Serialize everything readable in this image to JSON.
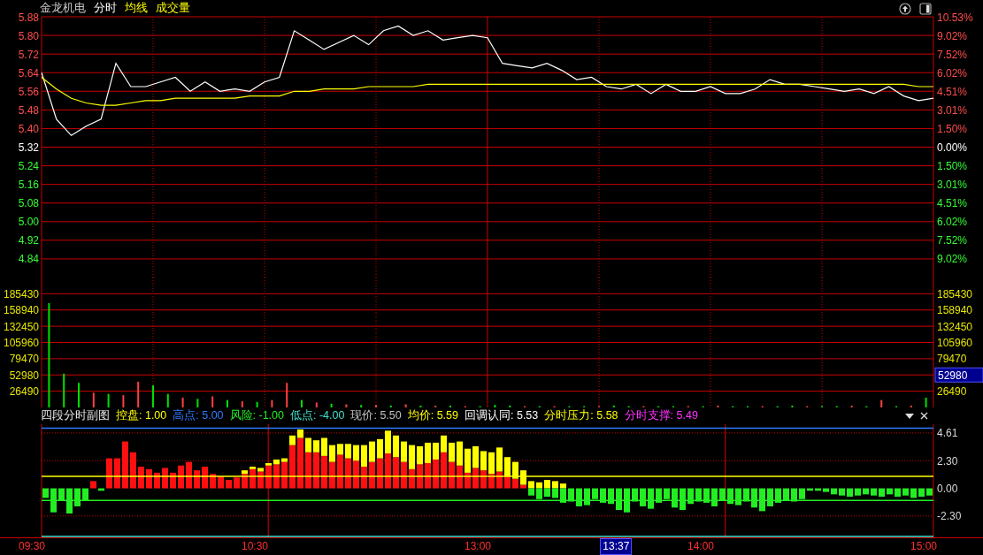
{
  "header": {
    "title": "金龙机电",
    "volume_label": "成交量"
  },
  "price_chart": {
    "percent_labels": [
      {
        "text": "10.53%",
        "color": "#ff4d4d"
      },
      {
        "text": "9.02%",
        "color": "#ff4d4d"
      },
      {
        "text": "7.52%",
        "color": "#ff4d4d"
      },
      {
        "text": "6.02%",
        "color": "#ff4d4d"
      },
      {
        "text": "4.51%",
        "color": "#ff4d4d"
      },
      {
        "text": "3.01%",
        "color": "#ff4d4d"
      },
      {
        "text": "1.50%",
        "color": "#ff4d4d"
      },
      {
        "text": "0.00%",
        "color": "#ffffff"
      },
      {
        "text": "1.50%",
        "color": "#33ff33"
      },
      {
        "text": "3.01%",
        "color": "#33ff33"
      },
      {
        "text": "4.51%",
        "color": "#33ff33"
      },
      {
        "text": "6.02%",
        "color": "#33ff33"
      },
      {
        "text": "7.52%",
        "color": "#33ff33"
      },
      {
        "text": "9.02%",
        "color": "#33ff33"
      }
    ],
    "chart_data": {
      "type": "line",
      "grid": true,
      "ylim": [
        4.76,
        5.88
      ],
      "yticks": [
        {
          "value": 5.88,
          "label": "5.88"
        },
        {
          "value": 5.8,
          "label": "5.80"
        },
        {
          "value": 5.72,
          "label": "5.72"
        },
        {
          "value": 5.64,
          "label": "5.64"
        },
        {
          "value": 5.56,
          "label": "5.56"
        },
        {
          "value": 5.48,
          "label": "5.48"
        },
        {
          "value": 5.4,
          "label": "5.40"
        },
        {
          "value": 5.32,
          "label": "5.32"
        },
        {
          "value": 5.24,
          "label": "5.24"
        },
        {
          "value": 5.16,
          "label": "5.16"
        },
        {
          "value": 5.08,
          "label": "5.08"
        },
        {
          "value": 5.0,
          "label": "5.00"
        },
        {
          "value": 4.92,
          "label": "4.92"
        },
        {
          "value": 4.84,
          "label": "4.84"
        }
      ],
      "series": [
        {
          "name": "分时",
          "color": "#ffffff",
          "values": [
            5.64,
            5.44,
            5.37,
            5.41,
            5.44,
            5.68,
            5.58,
            5.58,
            5.6,
            5.62,
            5.56,
            5.6,
            5.56,
            5.57,
            5.56,
            5.6,
            5.62,
            5.82,
            5.78,
            5.74,
            5.77,
            5.8,
            5.76,
            5.82,
            5.84,
            5.8,
            5.82,
            5.78,
            5.79,
            5.8,
            5.79,
            5.68,
            5.67,
            5.66,
            5.68,
            5.65,
            5.61,
            5.62,
            5.58,
            5.57,
            5.59,
            5.55,
            5.59,
            5.56,
            5.56,
            5.58,
            5.55,
            5.55,
            5.57,
            5.61,
            5.59,
            5.59,
            5.58,
            5.57,
            5.56,
            5.57,
            5.55,
            5.58,
            5.54,
            5.52,
            5.53
          ]
        },
        {
          "name": "均线",
          "color": "#ffff00",
          "values": [
            5.62,
            5.57,
            5.53,
            5.51,
            5.5,
            5.5,
            5.51,
            5.52,
            5.52,
            5.53,
            5.53,
            5.53,
            5.53,
            5.53,
            5.54,
            5.54,
            5.54,
            5.56,
            5.56,
            5.57,
            5.57,
            5.57,
            5.58,
            5.58,
            5.58,
            5.58,
            5.59,
            5.59,
            5.59,
            5.59,
            5.59,
            5.59,
            5.59,
            5.59,
            5.59,
            5.59,
            5.59,
            5.59,
            5.59,
            5.59,
            5.59,
            5.59,
            5.59,
            5.59,
            5.59,
            5.59,
            5.59,
            5.59,
            5.59,
            5.59,
            5.59,
            5.59,
            5.59,
            5.59,
            5.59,
            5.59,
            5.59,
            5.59,
            5.59,
            5.58,
            5.58
          ]
        }
      ]
    }
  },
  "volume_chart": {
    "right_labels": [
      "185430",
      "158940",
      "132450",
      "105960",
      "79470",
      "26490"
    ],
    "cursor_value": "52980",
    "chart_data": {
      "type": "bar",
      "grid": true,
      "ylim": [
        0,
        211920
      ],
      "yticks": [
        {
          "value": 185430,
          "label": "185430"
        },
        {
          "value": 158940,
          "label": "158940"
        },
        {
          "value": 132450,
          "label": "132450"
        },
        {
          "value": 105960,
          "label": "105960"
        },
        {
          "value": 79470,
          "label": "79470"
        },
        {
          "value": 52980,
          "label": "52980"
        },
        {
          "value": 26490,
          "label": "26490"
        }
      ],
      "series": [
        {
          "color": "#ff4040",
          "values": [
            null,
            null,
            null,
            24000,
            null,
            20000,
            42000,
            null,
            null,
            16000,
            null,
            18000,
            null,
            10000,
            null,
            12000,
            40000,
            null,
            8000,
            null,
            5000,
            null,
            4000,
            null,
            5000,
            null,
            3000,
            null,
            2000,
            null,
            null,
            null,
            2000,
            null,
            2000,
            null,
            null,
            2000,
            null,
            null,
            2000,
            null,
            null,
            2000,
            null,
            3000,
            null,
            null,
            2000,
            null,
            null,
            2000,
            null,
            null,
            3000,
            null,
            12000,
            null,
            3000,
            null
          ]
        },
        {
          "color": "#00e000",
          "values": [
            170000,
            55000,
            40000,
            null,
            22000,
            null,
            null,
            36000,
            22000,
            null,
            14000,
            null,
            12000,
            null,
            9000,
            null,
            null,
            12000,
            null,
            6000,
            null,
            4000,
            null,
            3000,
            null,
            3000,
            null,
            3000,
            null,
            2000,
            4000,
            3000,
            null,
            2000,
            null,
            2000,
            2000,
            null,
            3000,
            2000,
            null,
            2000,
            2000,
            null,
            2000,
            null,
            2000,
            2000,
            null,
            2000,
            3000,
            null,
            2000,
            2000,
            null,
            2000,
            null,
            2000,
            null,
            16000
          ]
        }
      ]
    }
  },
  "indicator": {
    "title": "四段分时副图",
    "items": [
      {
        "text": "现价: 5.50",
        "color": "#c0c0c0"
      },
      {
        "text": "均价: 5.59",
        "color": "#ffff00"
      },
      {
        "text": "回调认同: 5.53",
        "color": "#ffffff"
      },
      {
        "text": "分时压力: 5.58",
        "color": "#ffff00"
      },
      {
        "text": "分时支撑: 5.49",
        "color": "#ff33ff"
      }
    ],
    "time_labels": [
      "09:30",
      "10:30",
      "13:00",
      "14:00",
      "15:00"
    ],
    "cursor_time": "13:37",
    "chart_data": {
      "type": "bar",
      "stacked": true,
      "grid": true,
      "ylim": [
        -4.08,
        5.34
      ],
      "yticks": [
        {
          "value": 4.61,
          "label": "4.61"
        },
        {
          "value": 2.3,
          "label": "2.30"
        },
        {
          "value": 0,
          "label": "0.00"
        },
        {
          "value": -2.3,
          "label": "-2.30"
        }
      ],
      "ref_lines": [
        {
          "axis": "y",
          "value": 1,
          "label": "控盘: 1.00",
          "color": "#ffff00"
        },
        {
          "axis": "y",
          "value": 5,
          "label": "高点: 5.00",
          "color": "#2f7bff"
        },
        {
          "axis": "y",
          "value": -1,
          "label": "风险: -1.00",
          "color": "#22ee22"
        },
        {
          "axis": "y",
          "value": -4,
          "label": "低点: -4.00",
          "color": "#40e0d0"
        }
      ],
      "series": [
        {
          "color": "#ff1010",
          "values": [
            null,
            null,
            null,
            null,
            null,
            null,
            0.6,
            null,
            2.5,
            2.5,
            3.9,
            3.0,
            1.8,
            1.6,
            1.3,
            1.7,
            1.3,
            1.9,
            2.2,
            1.5,
            1.8,
            1.2,
            1.0,
            0.7,
            0.9,
            1.2,
            1.6,
            1.4,
            1.9,
            2.0,
            2.2,
            3.6,
            4.2,
            3.0,
            3.0,
            2.7,
            2.2,
            2.8,
            2.5,
            2.3,
            1.8,
            2.2,
            2.5,
            2.9,
            2.6,
            2.2,
            1.6,
            2.0,
            2.1,
            2.4,
            3.0,
            2.2,
            1.9,
            1.3,
            1.7,
            1.5,
            1.2,
            1.4,
            1.0,
            0.8,
            0.3,
            null,
            null,
            null,
            null,
            null,
            null,
            null,
            null,
            null,
            null,
            null,
            null,
            null,
            null,
            null,
            null,
            null,
            null,
            null,
            null,
            null,
            null,
            null,
            null,
            null,
            null,
            null,
            null,
            null,
            null,
            null,
            null,
            null,
            null,
            null,
            null,
            null,
            null,
            null,
            null,
            null,
            null,
            null,
            null,
            null,
            null,
            null,
            null,
            null,
            null,
            null
          ]
        },
        {
          "color": "#ffff00",
          "values": [
            null,
            null,
            null,
            null,
            null,
            null,
            null,
            null,
            null,
            null,
            null,
            null,
            null,
            null,
            null,
            null,
            null,
            null,
            null,
            null,
            null,
            null,
            null,
            null,
            null,
            0.3,
            0.2,
            0.3,
            0.2,
            0.4,
            0.3,
            0.8,
            0.7,
            1.2,
            1.0,
            1.5,
            1.4,
            0.9,
            1.2,
            1.3,
            1.8,
            1.7,
            1.6,
            1.9,
            1.8,
            1.7,
            2.0,
            1.5,
            1.7,
            1.4,
            1.4,
            1.6,
            2.0,
            2.0,
            1.8,
            1.6,
            1.8,
            2.0,
            1.6,
            1.4,
            1.2,
            0.6,
            0.5,
            0.7,
            0.6,
            0.4,
            null,
            null,
            null,
            null,
            null,
            null,
            null,
            null,
            null,
            null,
            null,
            null,
            null,
            null,
            null,
            null,
            null,
            null,
            null,
            null,
            null,
            null,
            null,
            null,
            null,
            null,
            null,
            null,
            null,
            null,
            null,
            null,
            null,
            null,
            null,
            null,
            null,
            null,
            null,
            null,
            null,
            null,
            null,
            null,
            null,
            null
          ]
        },
        {
          "color": "#22ee22",
          "values": [
            -0.8,
            -2.0,
            -1.0,
            -2.1,
            -1.5,
            -1.0,
            null,
            -0.2,
            null,
            null,
            null,
            null,
            null,
            null,
            null,
            null,
            null,
            null,
            null,
            null,
            null,
            null,
            null,
            null,
            null,
            null,
            null,
            null,
            null,
            null,
            null,
            null,
            null,
            null,
            null,
            null,
            null,
            null,
            null,
            null,
            null,
            null,
            null,
            null,
            null,
            null,
            null,
            null,
            null,
            null,
            null,
            null,
            null,
            null,
            null,
            null,
            null,
            null,
            null,
            null,
            null,
            -0.6,
            -0.9,
            -0.7,
            -0.8,
            -1.2,
            -1.1,
            -1.5,
            -1.4,
            -0.9,
            -1.2,
            -1.3,
            -1.8,
            -2.0,
            -1.1,
            -1.5,
            -1.7,
            -1.2,
            -0.9,
            -1.6,
            -1.8,
            -1.3,
            -1.1,
            -1.2,
            -1.5,
            -1.0,
            -1.3,
            -1.4,
            -1.1,
            -1.6,
            -1.9,
            -1.5,
            -1.2,
            -1.0,
            -1.1,
            -0.9,
            -0.2,
            -0.2,
            -0.3,
            -0.5,
            -0.6,
            -0.7,
            -0.6,
            -0.5,
            -0.6,
            -0.7,
            -0.5,
            -0.7,
            -0.6,
            -0.8,
            -0.7,
            -0.6
          ]
        }
      ]
    }
  }
}
